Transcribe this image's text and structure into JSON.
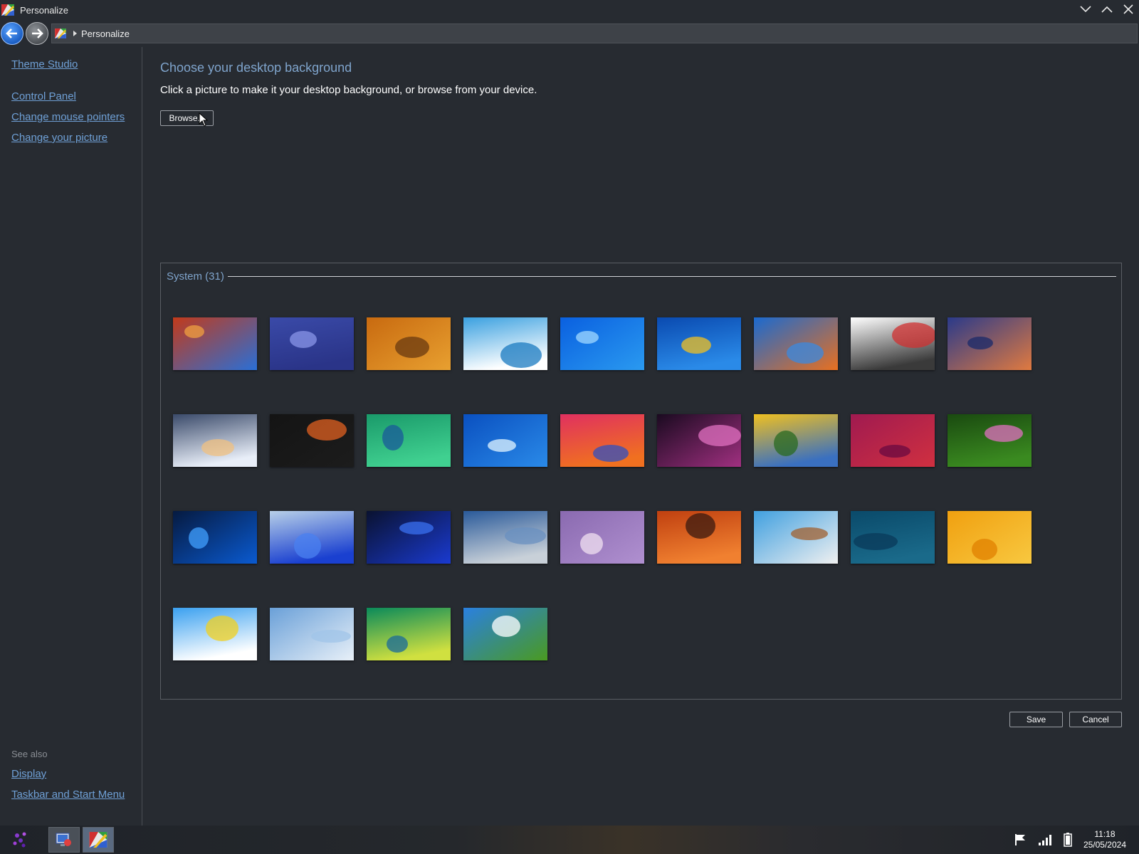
{
  "window": {
    "title": "Personalize",
    "minimize_icon": "chevron-down-icon",
    "maximize_icon": "chevron-up-icon",
    "close_icon": "close-icon"
  },
  "address": {
    "breadcrumb": "Personalize"
  },
  "sidebar": {
    "top_links": [
      "Theme Studio",
      "Control Panel",
      "Change mouse pointers",
      "Change your picture"
    ],
    "see_also_label": "See also",
    "see_also_links": [
      "Display",
      "Taskbar and Start Menu"
    ]
  },
  "main": {
    "title": "Choose your desktop background",
    "subtitle": "Click a picture to make it your desktop background, or browse from your device.",
    "browse_label": "Browse..."
  },
  "gallery": {
    "group_label": "System (31)",
    "thumbnails": [
      {
        "name": "space-needle",
        "colors": [
          "#c23a1a",
          "#2a6fd6",
          "#f0a040"
        ]
      },
      {
        "name": "moon-mountain",
        "colors": [
          "#3a4aa8",
          "#2a3488",
          "#8a96e8"
        ]
      },
      {
        "name": "autumn-road",
        "colors": [
          "#c86a10",
          "#e8a030",
          "#6a3a10"
        ]
      },
      {
        "name": "tropical-island",
        "colors": [
          "#3aa0e0",
          "#ffffff",
          "#1a7ac0"
        ]
      },
      {
        "name": "blue-wave",
        "colors": [
          "#0a60e0",
          "#2a9af0",
          "#a0d8ff"
        ]
      },
      {
        "name": "windows-7",
        "colors": [
          "#0a4ab0",
          "#2a8ae8",
          "#f0c020"
        ]
      },
      {
        "name": "orange-fish",
        "colors": [
          "#1a6ad0",
          "#e87020",
          "#3a8ae0"
        ]
      },
      {
        "name": "suitcase",
        "colors": [
          "#ffffff",
          "#3a3a3a",
          "#d03030"
        ]
      },
      {
        "name": "abstract-shapes",
        "colors": [
          "#2a3a8a",
          "#e07a40",
          "#1a2a6a"
        ]
      },
      {
        "name": "ice-lake",
        "colors": [
          "#3a4a6a",
          "#e8eef8",
          "#f0c080"
        ]
      },
      {
        "name": "dark-logo",
        "colors": [
          "#141414",
          "#1c1c1c",
          "#e06020"
        ]
      },
      {
        "name": "aurora-green",
        "colors": [
          "#1a9a6a",
          "#40d090",
          "#1a5a9a"
        ]
      },
      {
        "name": "blue-glow",
        "colors": [
          "#0a50c0",
          "#2a8ae8",
          "#e0f4ff"
        ]
      },
      {
        "name": "big-sur-gradient",
        "colors": [
          "#e03060",
          "#f07020",
          "#3050c0"
        ]
      },
      {
        "name": "purple-flower",
        "colors": [
          "#1a0a20",
          "#a03080",
          "#e070c0"
        ]
      },
      {
        "name": "yellow-tulips",
        "colors": [
          "#f0c020",
          "#3a70c0",
          "#2a6a20"
        ]
      },
      {
        "name": "magenta-jellyfish",
        "colors": [
          "#a01a50",
          "#d03040",
          "#6a0a40"
        ]
      },
      {
        "name": "water-lilies",
        "colors": [
          "#1a4a10",
          "#3a8a20",
          "#e070c0"
        ]
      },
      {
        "name": "windows-10",
        "colors": [
          "#061a40",
          "#0a5ad0",
          "#40a0ff"
        ]
      },
      {
        "name": "windows-11-bloom-light",
        "colors": [
          "#b8d0e8",
          "#1a40d0",
          "#4a80f0"
        ]
      },
      {
        "name": "windows-11-bloom-dark",
        "colors": [
          "#0a1230",
          "#1a3ad0",
          "#3a70f0"
        ]
      },
      {
        "name": "dome-building",
        "colors": [
          "#2a5a9a",
          "#c8d0d8",
          "#6a90c0"
        ]
      },
      {
        "name": "lavender-field",
        "colors": [
          "#8a6ab0",
          "#b090d0",
          "#f0e0f0"
        ]
      },
      {
        "name": "red-canyon",
        "colors": [
          "#c04010",
          "#f08030",
          "#3a1a10"
        ]
      },
      {
        "name": "floating-island",
        "colors": [
          "#40a0e0",
          "#f0f0f0",
          "#a06030"
        ]
      },
      {
        "name": "teal-abstract",
        "colors": [
          "#0a4a6a",
          "#1a6a8a",
          "#0a3a5a"
        ]
      },
      {
        "name": "yellow-geometric",
        "colors": [
          "#f0a010",
          "#f8c840",
          "#e08000"
        ]
      },
      {
        "name": "daisies-sky",
        "colors": [
          "#3aa0f0",
          "#ffffff",
          "#f0d020"
        ]
      },
      {
        "name": "clouds",
        "colors": [
          "#6aa0d8",
          "#e8f0f8",
          "#a0c4e8"
        ]
      },
      {
        "name": "vista-aurora",
        "colors": [
          "#0a8a5a",
          "#d0e040",
          "#1a6a9a"
        ]
      },
      {
        "name": "bliss-hill",
        "colors": [
          "#2a80e0",
          "#4a9a20",
          "#ffffff"
        ]
      }
    ]
  },
  "actions": {
    "save_label": "Save",
    "cancel_label": "Cancel"
  },
  "taskbar": {
    "start_icon": "start-logo-icon",
    "items": [
      "control-panel-app",
      "personalize-app"
    ],
    "tray_icons": [
      "flag-icon",
      "signal-icon",
      "battery-icon"
    ],
    "time": "11:18",
    "date": "25/05/2024"
  }
}
